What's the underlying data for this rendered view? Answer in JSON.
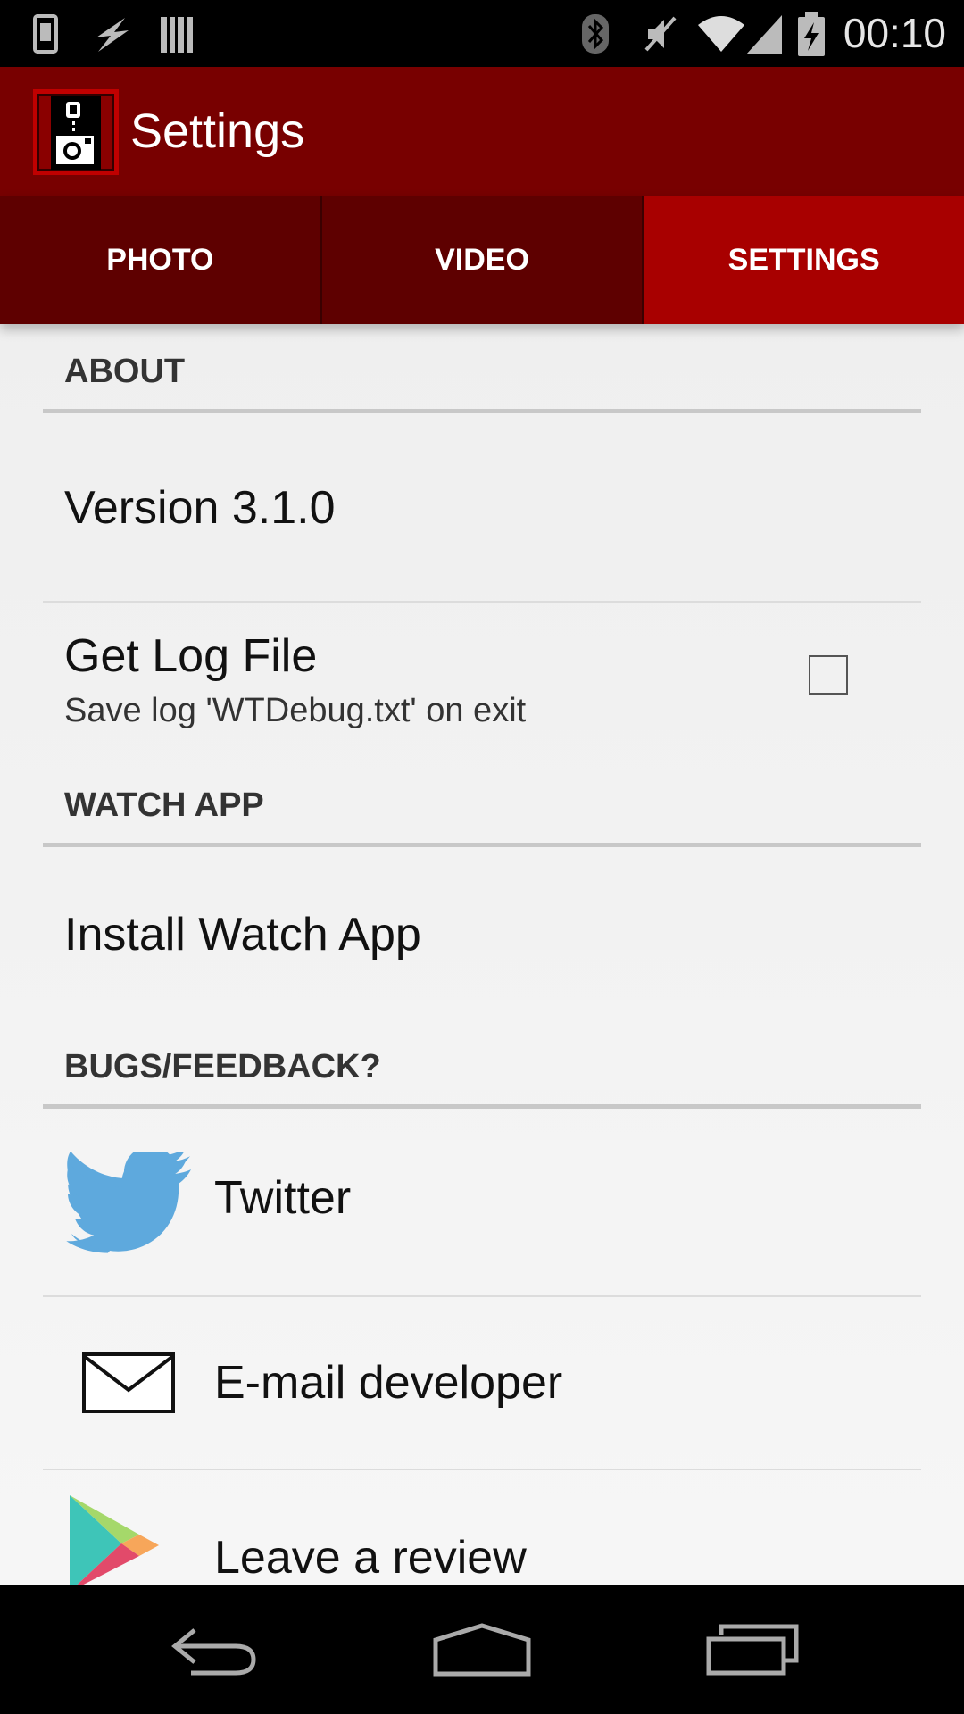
{
  "status_bar": {
    "time": "00:10",
    "left_icons": [
      "phone-icon",
      "flash-icon",
      "barcode-icon"
    ],
    "right_icons": [
      "bluetooth-icon",
      "mute-icon",
      "wifi-icon",
      "signal-icon",
      "battery-icon"
    ]
  },
  "action_bar": {
    "title": "Settings",
    "brand_color": "#780000"
  },
  "tabs": [
    {
      "label": "PHOTO",
      "active": false
    },
    {
      "label": "VIDEO",
      "active": false
    },
    {
      "label": "SETTINGS",
      "active": true
    }
  ],
  "sections": {
    "about": {
      "header": "ABOUT",
      "version_label": "Version 3.1.0",
      "log_title": "Get Log File",
      "log_subtitle": "Save log 'WTDebug.txt' on exit",
      "log_checked": false
    },
    "watch": {
      "header": "WATCH APP",
      "install_label": "Install Watch App"
    },
    "feedback": {
      "header": "BUGS/FEEDBACK?",
      "items": [
        {
          "label": "Twitter",
          "icon": "twitter-icon"
        },
        {
          "label": "E-mail developer",
          "icon": "envelope-icon"
        },
        {
          "label": "Leave a review",
          "icon": "play-store-icon"
        }
      ]
    }
  },
  "nav_bar": {
    "buttons": [
      "back-icon",
      "home-icon",
      "recents-icon"
    ]
  },
  "colors": {
    "tab_active": "#a80000",
    "tab_inactive": "#5e0000",
    "twitter_blue": "#5ea9dd"
  }
}
